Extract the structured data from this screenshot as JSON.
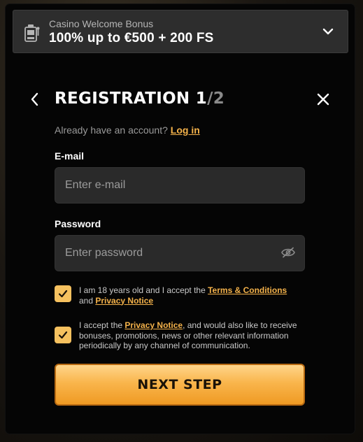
{
  "bonus": {
    "label": "Casino Welcome Bonus",
    "title": "100% up to €500 + 200 FS",
    "icon": "slot-machine-icon"
  },
  "header": {
    "title_main": "REGISTRATION 1",
    "title_total": "/2"
  },
  "login": {
    "prompt": "Already have an account?",
    "link": "Log in"
  },
  "form": {
    "email_label": "E-mail",
    "email_placeholder": "Enter e-mail",
    "password_label": "Password",
    "password_placeholder": "Enter password"
  },
  "consents": [
    {
      "checked": true,
      "text_before": "I am 18 years old and I accept the ",
      "link1": "Terms & Conditions",
      "text_mid": " and ",
      "link2": "Privacy Notice"
    },
    {
      "checked": true,
      "text_before": "I accept the ",
      "link1": "Privacy Notice",
      "text_after": ", and would also like to receive bonuses, promotions, news or other relevant information periodically by any channel of communication."
    }
  ],
  "next_button": "NEXT STEP",
  "colors": {
    "accent": "#f4b24a",
    "checkbox": "#f6c15f",
    "input_bg": "#2a2a2a",
    "modal_bg": "#050505"
  }
}
